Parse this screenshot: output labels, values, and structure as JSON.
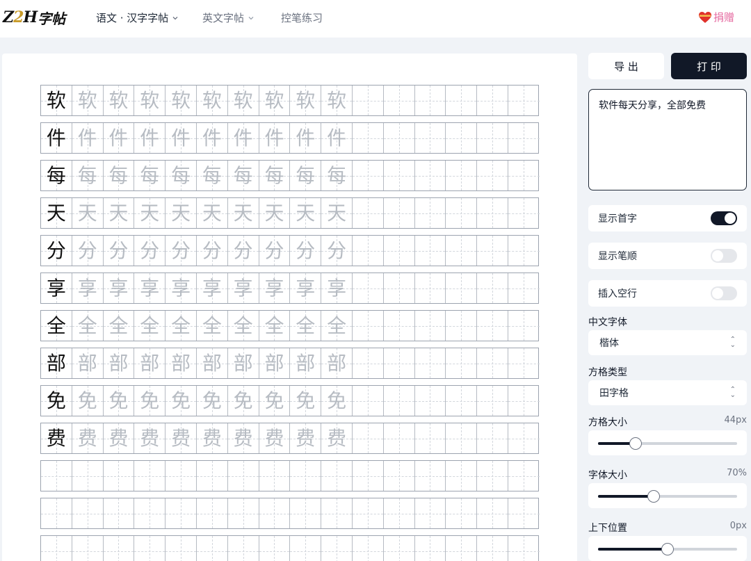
{
  "header": {
    "logo_text": "Z2H字帖",
    "nav": [
      {
        "label": "语文 · 汉字字帖",
        "has_dropdown": true,
        "active": true
      },
      {
        "label": "英文字帖",
        "has_dropdown": true,
        "active": false
      },
      {
        "label": "控笔练习",
        "has_dropdown": false,
        "active": false
      }
    ],
    "donate_label": "捐赠"
  },
  "worksheet": {
    "characters": [
      "软",
      "件",
      "每",
      "天",
      "分",
      "享",
      "全",
      "部",
      "免",
      "费"
    ],
    "trace_repeats": 9,
    "cells_per_row": 16,
    "empty_rows": 3
  },
  "sidebar": {
    "export_label": "导 出",
    "print_label": "打 印",
    "text_value": "软件每天分享，全部免费",
    "toggles": [
      {
        "label": "显示首字",
        "on": true
      },
      {
        "label": "显示笔顺",
        "on": false
      },
      {
        "label": "插入空行",
        "on": false
      }
    ],
    "font": {
      "label": "中文字体",
      "value": "楷体"
    },
    "grid_type": {
      "label": "方格类型",
      "value": "田字格"
    },
    "sliders": [
      {
        "label": "方格大小",
        "value_text": "44px",
        "fraction": 0.27
      },
      {
        "label": "字体大小",
        "value_text": "70%",
        "fraction": 0.4
      },
      {
        "label": "上下位置",
        "value_text": "0px",
        "fraction": 0.5
      }
    ]
  },
  "colors": {
    "accent": "#111827",
    "donate": "#e56aa0",
    "trace": "#b7bcc3"
  }
}
